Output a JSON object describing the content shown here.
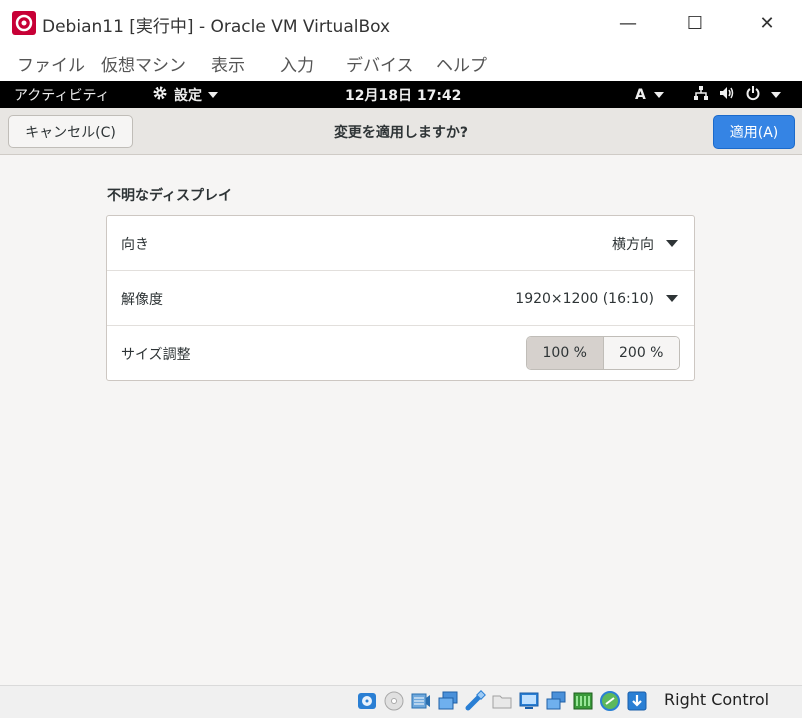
{
  "window": {
    "title": "Debian11 [実行中] - Oracle VM VirtualBox",
    "minimize_symbol": "—",
    "maximize_symbol": "☐",
    "close_symbol": "✕"
  },
  "vbox_menu": [
    "ファイル",
    "仮想マシン",
    "表示",
    "入力",
    "デバイス",
    "ヘルプ"
  ],
  "gnome_topbar": {
    "activities": "アクティビティ",
    "app_name": "設定",
    "clock": "12月18日  17:42",
    "input_source": "A",
    "icons": [
      "gear-icon",
      "network-icon",
      "volume-icon",
      "power-icon"
    ]
  },
  "confirm_bar": {
    "cancel_label": "キャンセル(C)",
    "title": "変更を適用しますか?",
    "apply_label": "適用(A)"
  },
  "display": {
    "section_title": "不明なディスプレイ",
    "orientation_label": "向き",
    "orientation_value": "横方向",
    "resolution_label": "解像度",
    "resolution_value": "1920×1200 (16:10)",
    "scale_label": "サイズ調整",
    "scale_options": [
      "100 %",
      "200 %"
    ],
    "scale_selected": "100 %"
  },
  "status_bar": {
    "icons": [
      "hard-disk-icon",
      "optical-drive-icon",
      "audio-icon",
      "network-adapter-icon",
      "usb-icon",
      "shared-folder-icon",
      "display-icon",
      "video-capture-icon",
      "recording-icon",
      "mouse-integration-icon",
      "host-key-icon"
    ],
    "host_key": "Right Control"
  },
  "colors": {
    "accent": "#3584e4",
    "topbar": "#000000",
    "window_bg": "#f6f5f4"
  }
}
